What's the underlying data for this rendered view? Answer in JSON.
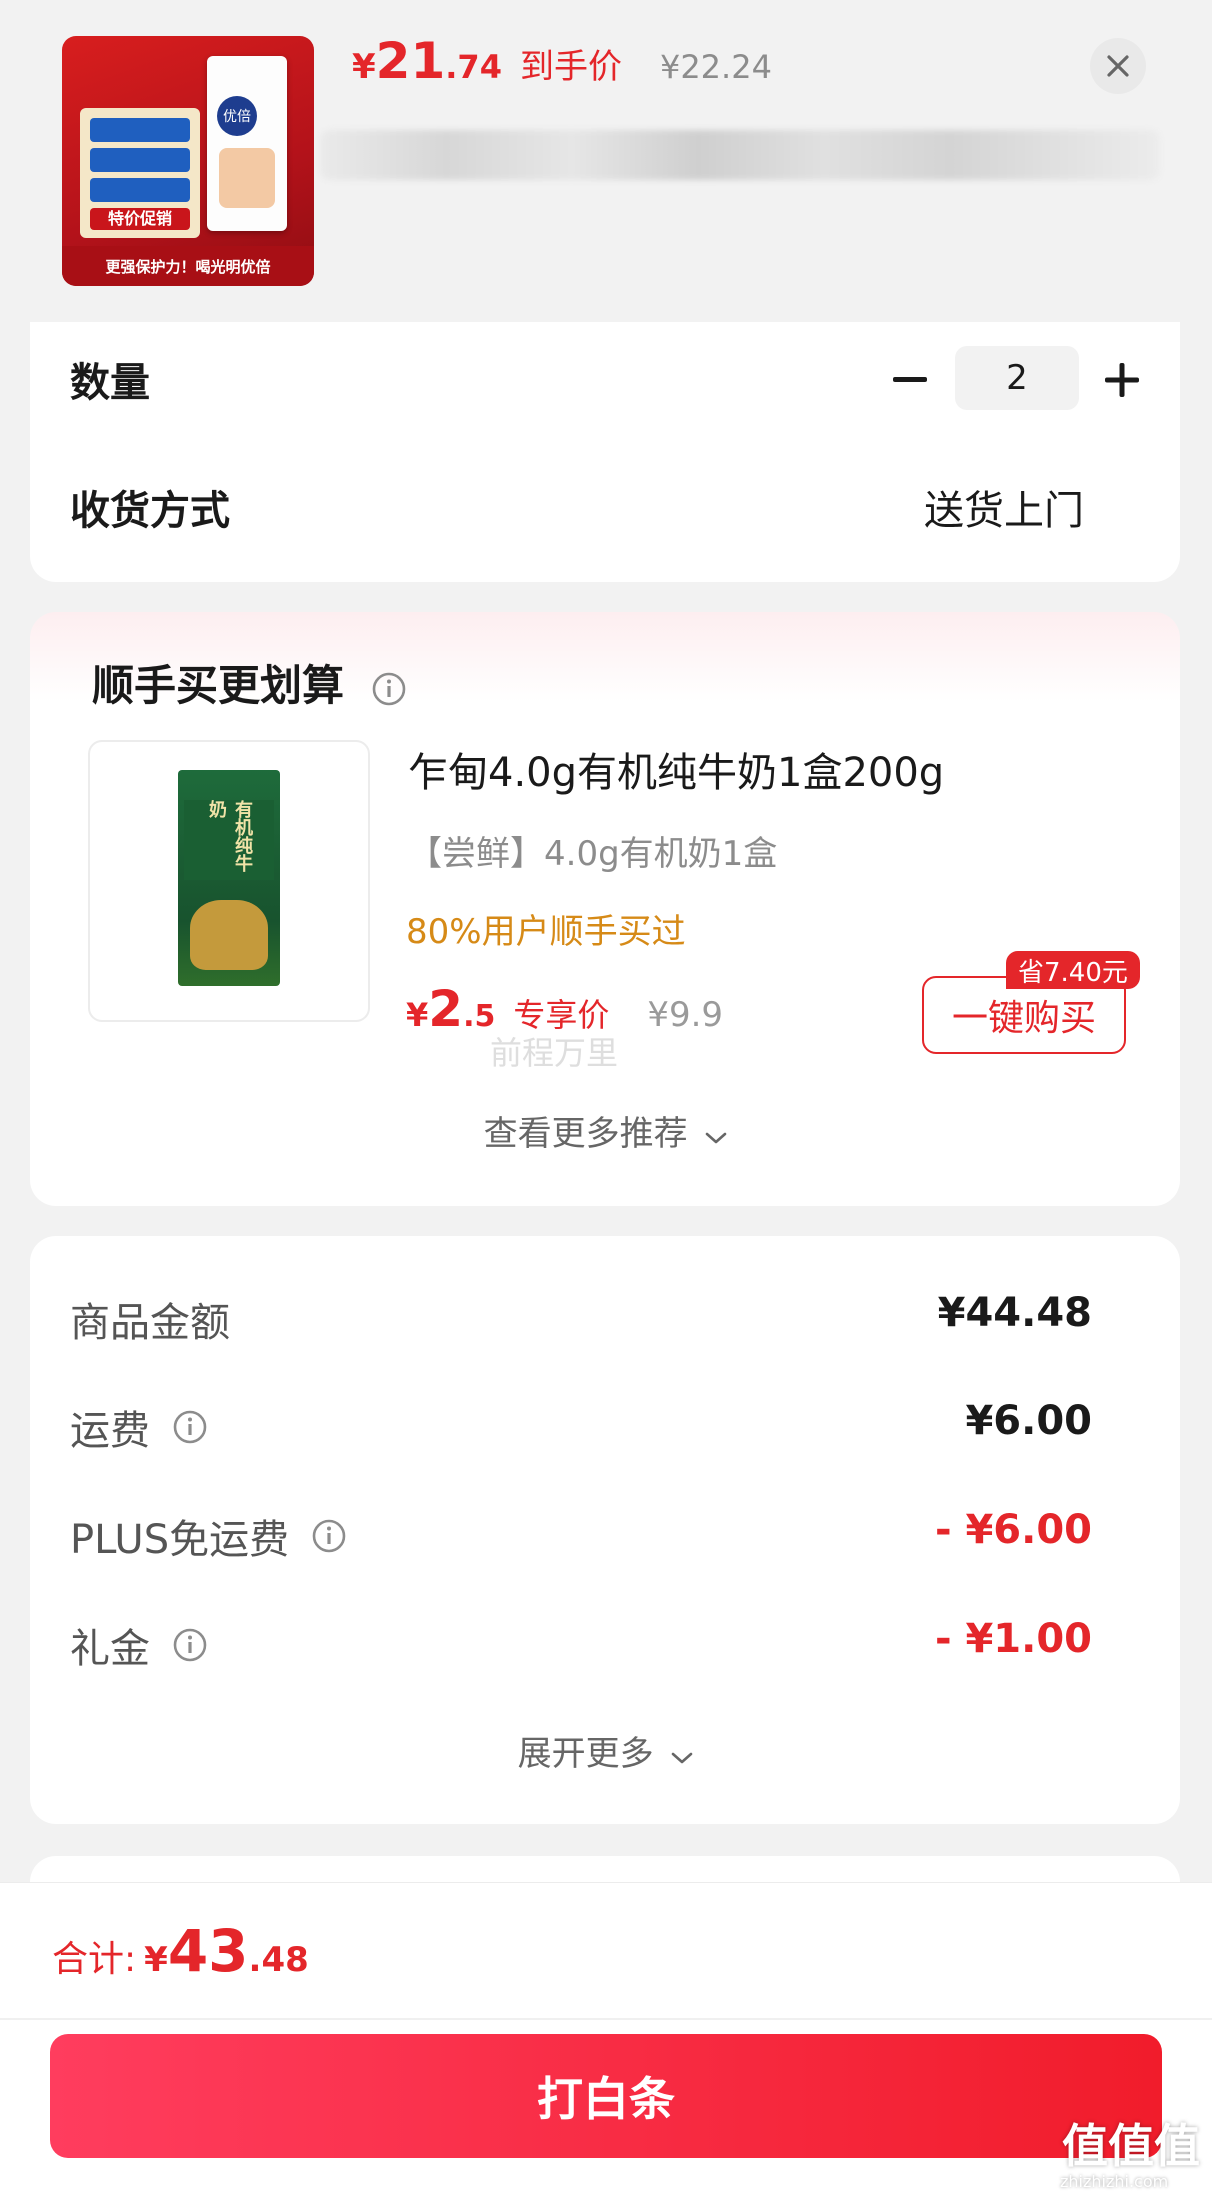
{
  "product": {
    "price_currency": "¥",
    "price_integer": "21",
    "price_decimal": ".74",
    "final_price_label": "到手价",
    "original_price": "¥22.24",
    "thumbnail_brand_text": "优倍",
    "thumbnail_promo_text": "特价促销",
    "thumbnail_slogan": "更强保护力！喝光明优倍"
  },
  "options": {
    "quantity_label": "数量",
    "quantity_value": "2",
    "delivery_label": "收货方式",
    "delivery_value": "送货上门"
  },
  "recommend": {
    "section_title": "顺手买更划算",
    "item_name": "乍甸4.0g有机纯牛奶1盒200g",
    "item_subtitle": "【尝鲜】4.0g有机奶1盒",
    "item_buyers": "80%用户顺手买过",
    "item_price_currency": "¥",
    "item_price_integer": "2",
    "item_price_decimal": ".5",
    "item_price_label": "专享价",
    "item_original_price": "¥9.9",
    "save_tag": "省7.40元",
    "buy_button": "一键购买",
    "thumbnail_text": "有机纯牛奶",
    "watermark": "前程万里",
    "more_link": "查看更多推荐"
  },
  "breakdown": {
    "rows": [
      {
        "label": "商品金额",
        "value": "¥44.48",
        "has_info": false,
        "red": false
      },
      {
        "label": "运费",
        "value": "¥6.00",
        "has_info": true,
        "red": false
      },
      {
        "label": "PLUS免运费",
        "value": "- ¥6.00",
        "has_info": true,
        "red": true
      },
      {
        "label": "礼金",
        "value": "- ¥1.00",
        "has_info": true,
        "red": true
      }
    ],
    "expand_more": "展开更多"
  },
  "footer": {
    "total_label": "合计:",
    "total_currency": "¥",
    "total_integer": "43",
    "total_decimal": ".48",
    "pay_button": "打白条",
    "corner_logo": "值值值",
    "corner_url": "zhizhizhi.com"
  },
  "colors": {
    "accent_red": "#e4262a",
    "buyers_orange": "#d68a17"
  }
}
